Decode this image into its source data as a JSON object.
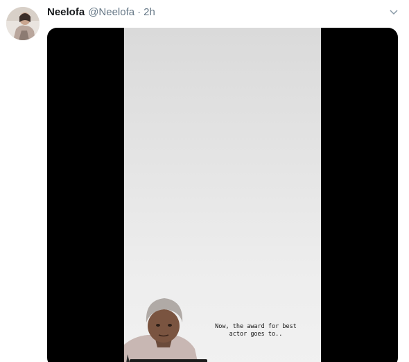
{
  "tweet": {
    "display_name": "Neelofa",
    "handle": "@Neelofa",
    "separator": "·",
    "timestamp": "2h"
  },
  "media": {
    "caption": "Now, the award for best\nactor goes to.."
  },
  "icons": {
    "avatar": "profile-photo",
    "menu": "chevron-down-icon"
  },
  "colors": {
    "name": "#14171a",
    "secondary_text": "#657786",
    "letterbox": "#000000"
  }
}
